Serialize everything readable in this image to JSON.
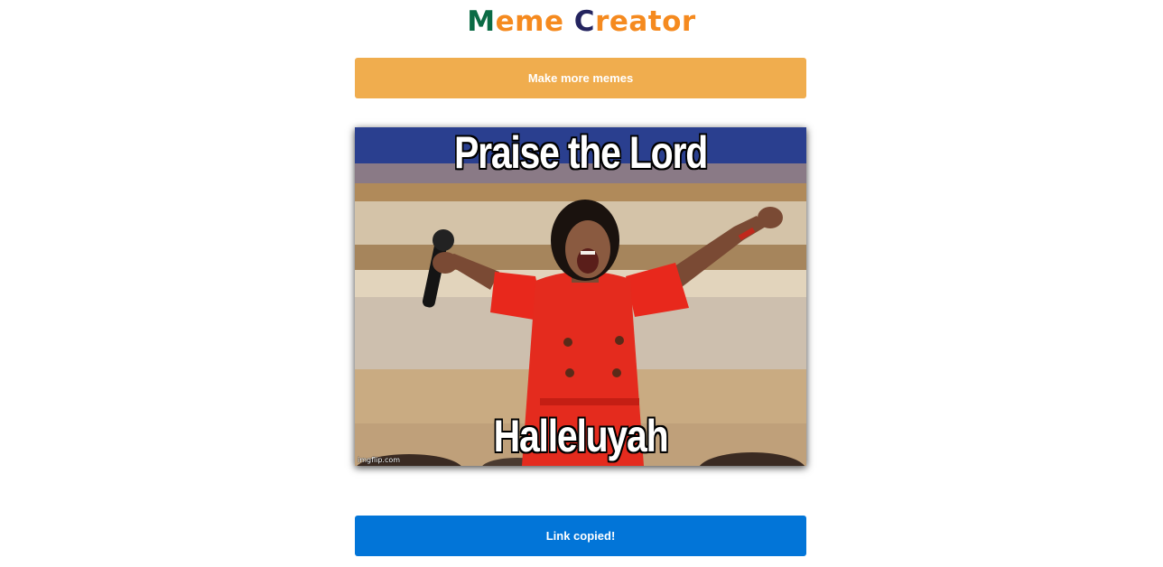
{
  "header": {
    "title_part1_initial": "M",
    "title_part1_rest": "eme",
    "title_part2_initial": "C",
    "title_part2_rest": "reator"
  },
  "actions": {
    "make_more_label": "Make more memes",
    "link_copied_label": "Link copied!"
  },
  "meme": {
    "top_text": "Praise the Lord",
    "bottom_text": "Halleluyah",
    "watermark": "imgflip.com"
  },
  "colors": {
    "title_green": "#0b6b45",
    "title_orange": "#f58a1f",
    "title_navy": "#24245f",
    "make_more_button": "#f0ad4e",
    "link_copied_button": "#0275d8"
  }
}
